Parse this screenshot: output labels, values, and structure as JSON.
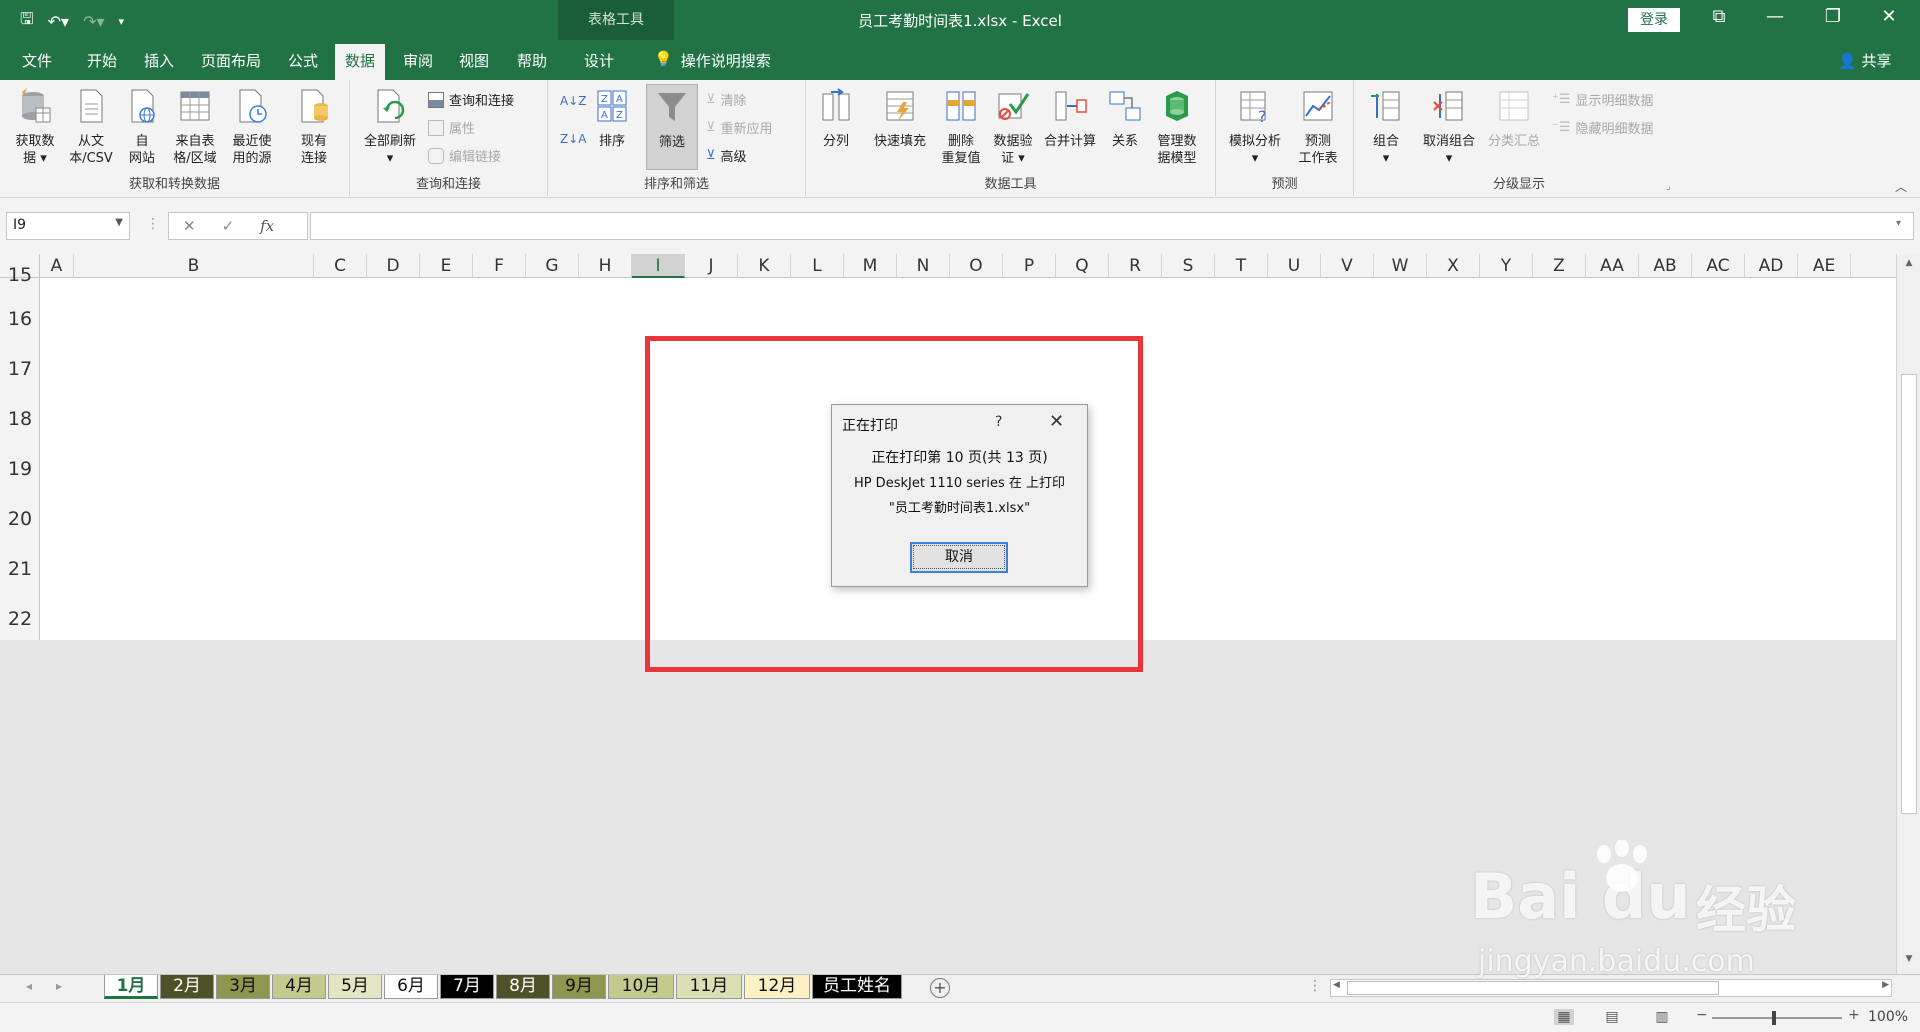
{
  "titlebar": {
    "context_tab": "表格工具",
    "doc_title": "员工考勤时间表1.xlsx  -  Excel",
    "login": "登录"
  },
  "ribbon_tabs": [
    "文件",
    "开始",
    "插入",
    "页面布局",
    "公式",
    "数据",
    "审阅",
    "视图",
    "帮助",
    "设计"
  ],
  "active_tab": "数据",
  "tell_me": "操作说明搜索",
  "share": "共享",
  "groups": {
    "get_transform": {
      "label": "获取和转换数据",
      "buttons": [
        "获取数\n据 ▾",
        "从文\n本/CSV",
        "自\n网站",
        "来自表\n格/区域",
        "最近使\n用的源",
        "现有\n连接"
      ]
    },
    "queries": {
      "label": "查询和连接",
      "refresh": "全部刷新\n▾",
      "items": [
        "查询和连接",
        "属性",
        "编辑链接"
      ]
    },
    "sort_filter": {
      "label": "排序和筛选",
      "sort": "排序",
      "filter": "筛选",
      "items": [
        "清除",
        "重新应用",
        "高级"
      ]
    },
    "data_tools": {
      "label": "数据工具",
      "buttons": [
        "分列",
        "快速填充",
        "删除\n重复值",
        "数据验\n证 ▾",
        "合并计算",
        "关系",
        "管理数\n据模型"
      ]
    },
    "forecast": {
      "label": "预测",
      "buttons": [
        "模拟分析\n▾",
        "预测\n工作表"
      ]
    },
    "outline": {
      "label": "分级显示",
      "buttons": [
        "组合\n▾",
        "取消组合\n▾",
        "分类汇总"
      ],
      "items": [
        "显示明细数据",
        "隐藏明细数据"
      ]
    }
  },
  "formula_bar": {
    "name_box": "I9",
    "fx": "fx",
    "formula": ""
  },
  "columns": [
    "A",
    "B",
    "C",
    "D",
    "E",
    "F",
    "G",
    "H",
    "I",
    "J",
    "K",
    "L",
    "M",
    "N",
    "O",
    "P",
    "Q",
    "R",
    "S",
    "T",
    "U",
    "V",
    "W",
    "X",
    "Y",
    "Z",
    "AA",
    "AB",
    "AC",
    "AD",
    "AE"
  ],
  "selected_column": "I",
  "rows": [
    "15",
    "16",
    "17",
    "18",
    "19",
    "20",
    "21",
    "22"
  ],
  "sheet_tabs": [
    {
      "label": "1月",
      "bg": "#ffffff",
      "fg": "#217346",
      "active": true
    },
    {
      "label": "2月",
      "bg": "#4f5228",
      "fg": "#ffffff"
    },
    {
      "label": "3月",
      "bg": "#8e9650",
      "fg": "#111111"
    },
    {
      "label": "4月",
      "bg": "#c4c98e",
      "fg": "#111111"
    },
    {
      "label": "5月",
      "bg": "#e3e5c4",
      "fg": "#111111"
    },
    {
      "label": "6月",
      "bg": "#ffffff",
      "fg": "#111111"
    },
    {
      "label": "7月",
      "bg": "#000000",
      "fg": "#ffffff"
    },
    {
      "label": "8月",
      "bg": "#4f5228",
      "fg": "#ffffff"
    },
    {
      "label": "9月",
      "bg": "#8e9650",
      "fg": "#111111"
    },
    {
      "label": "10月",
      "bg": "#c4c98e",
      "fg": "#111111"
    },
    {
      "label": "11月",
      "bg": "#dcdeb4",
      "fg": "#111111"
    },
    {
      "label": "12月",
      "bg": "#fbf1c4",
      "fg": "#111111"
    },
    {
      "label": "员工姓名",
      "bg": "#000000",
      "fg": "#ffffff"
    }
  ],
  "status": {
    "zoom": "100%"
  },
  "dialog": {
    "title": "正在打印",
    "help": "?",
    "line1": "正在打印第 10 页(共 13 页)",
    "line2": "HP DeskJet 1110 series 在  上打印",
    "line3": "\"员工考勤时间表1.xlsx\"",
    "cancel": "取消",
    "print_progress": {
      "current_page": 10,
      "total_pages": 13
    }
  },
  "watermark": {
    "brand": "Bai du",
    "cn": "经验",
    "url": "jingyan.baidu.com"
  },
  "colors": {
    "excel_green": "#217346",
    "highlight_red": "#e8363c",
    "ribbon_bg": "#f3f3f3"
  }
}
